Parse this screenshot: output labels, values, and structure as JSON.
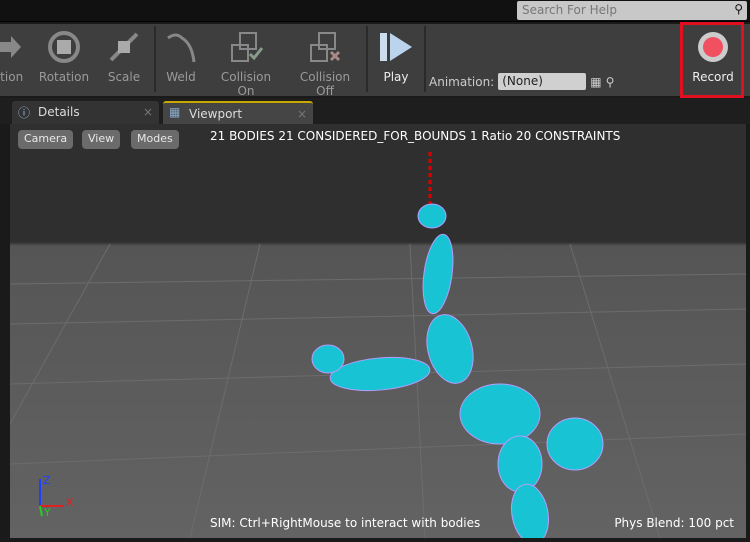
{
  "search": {
    "placeholder": "Search For Help"
  },
  "toolbar": {
    "translation": "ation",
    "rotation": "Rotation",
    "scale": "Scale",
    "weld": "Weld",
    "collision_on": "Collision On",
    "collision_off": "Collision Off",
    "play": "Play",
    "animation_label": "Animation:",
    "animation_value": "(None)",
    "record": "Record"
  },
  "tabs": [
    {
      "label": "Details"
    },
    {
      "label": "Viewport"
    }
  ],
  "viewport": {
    "buttons": [
      "Camera",
      "View",
      "Modes"
    ],
    "stats": "21 BODIES  21 CONSIDERED_FOR_BOUNDS  1 Ratio  20 CONSTRAINTS",
    "hint": "SIM: Ctrl+RightMouse to interact with bodies",
    "phys_blend": "Phys Blend: 100 pct",
    "axes": {
      "z": "Z",
      "x": "X",
      "y": "Y"
    }
  }
}
